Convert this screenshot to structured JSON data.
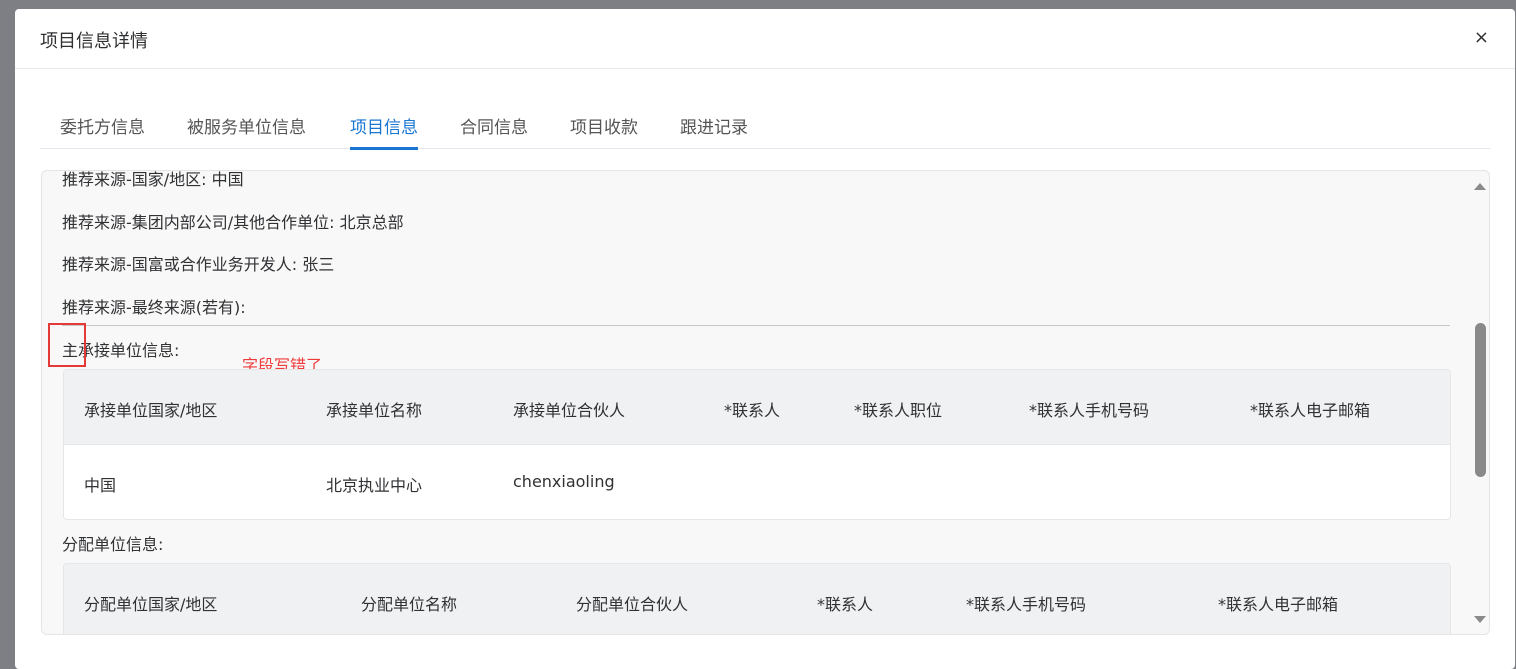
{
  "dialog": {
    "title": "项目信息详情",
    "close": "×"
  },
  "tabs": [
    {
      "label": "委托方信息"
    },
    {
      "label": "被服务单位信息"
    },
    {
      "label": "项目信息",
      "active": true
    },
    {
      "label": "合同信息"
    },
    {
      "label": "项目收款"
    },
    {
      "label": "跟进记录"
    }
  ],
  "fields": [
    "推荐来源-国家/地区: 中国",
    "推荐来源-集团内部公司/其他合作单位: 北京总部",
    "推荐来源-国富或合作业务开发人: 张三",
    "推荐来源-最终来源(若有):"
  ],
  "main_unit": {
    "label": "主承接单位信息:",
    "annotation": "字段写错了",
    "headers": [
      "承接单位国家/地区",
      "承接单位名称",
      "承接单位合伙人",
      "*联系人",
      "*联系人职位",
      "*联系人手机号码",
      "*联系人电子邮箱"
    ],
    "rows": [
      [
        "中国",
        "北京执业中心",
        "chenxiaoling",
        "",
        "",
        "",
        ""
      ]
    ]
  },
  "alloc_unit": {
    "label": "分配单位信息:",
    "headers": [
      "分配单位国家/地区",
      "分配单位名称",
      "分配单位合伙人",
      "*联系人",
      "*联系人手机号码",
      "*联系人电子邮箱"
    ]
  },
  "colors": {
    "accent": "#1976d2",
    "annotation": "#e53935"
  }
}
